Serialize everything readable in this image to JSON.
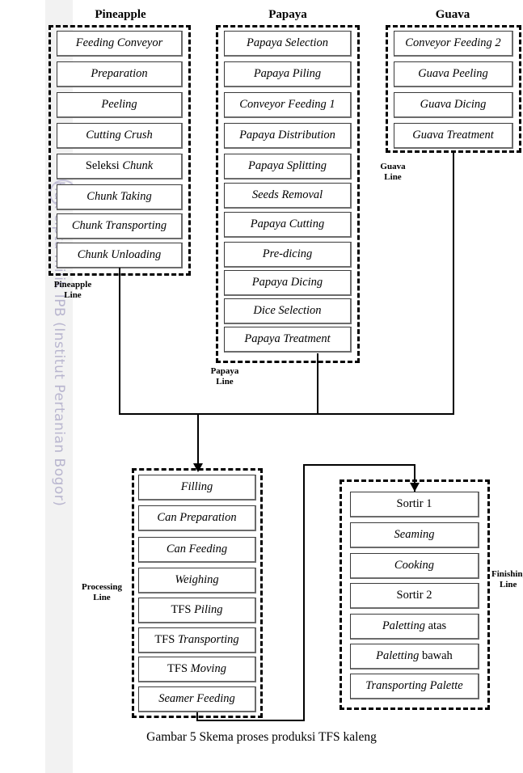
{
  "watermark": {
    "copyright_symbol": "©",
    "text": "Hak cipta milik IPB (Institut Pertanian Bogor)"
  },
  "caption": "Gambar 5 Skema proses produksi TFS kaleng",
  "columns": {
    "pineapple": {
      "title": "Pineapple",
      "line_label_line1": "Pineapple",
      "line_label_line2": "Line",
      "steps": [
        "Feeding Conveyor",
        "Preparation",
        "Peeling",
        "Cutting Crush",
        "Seleksi Chunk",
        "Chunk Taking",
        "Chunk Transporting",
        "Chunk Unloading"
      ]
    },
    "papaya": {
      "title": "Papaya",
      "line_label_line1": "Papaya",
      "line_label_line2": "Line",
      "steps": [
        "Papaya Selection",
        "Papaya Piling",
        "Conveyor Feeding 1",
        "Papaya Distribution",
        "Papaya Splitting",
        "Seeds Removal",
        "Papaya Cutting",
        "Pre-dicing",
        "Papaya Dicing",
        "Dice Selection",
        "Papaya Treatment"
      ]
    },
    "guava": {
      "title": "Guava",
      "line_label_line1": "Guava",
      "line_label_line2": "Line",
      "steps": [
        "Conveyor Feeding 2",
        "Guava Peeling",
        "Guava Dicing",
        "Guava Treatment"
      ]
    },
    "processing": {
      "line_label_line1": "Processing",
      "line_label_line2": "Line",
      "steps": [
        "Filling",
        "Can Preparation",
        "Can Feeding",
        "Weighing",
        "TFS Piling",
        "TFS Transporting",
        "TFS Moving",
        "Seamer Feeding"
      ]
    },
    "finishing": {
      "line_label_line1": "Finishing",
      "line_label_line2": "Line",
      "steps": [
        "Sortir 1",
        "Seaming",
        "Cooking",
        "Sortir 2",
        "Paletting atas",
        "Paletting bawah",
        "Transporting Palette"
      ]
    }
  },
  "diagram_data": {
    "type": "flowchart",
    "title": "Gambar 5 Skema proses produksi TFS kaleng",
    "groups": [
      "Pineapple Line",
      "Papaya Line",
      "Guava Line",
      "Processing Line",
      "Finishing Line"
    ],
    "flows": [
      "Pineapple Line -> Processing Line",
      "Papaya Line -> Processing Line",
      "Guava Line -> Processing Line",
      "Processing Line -> Finishing Line"
    ]
  }
}
